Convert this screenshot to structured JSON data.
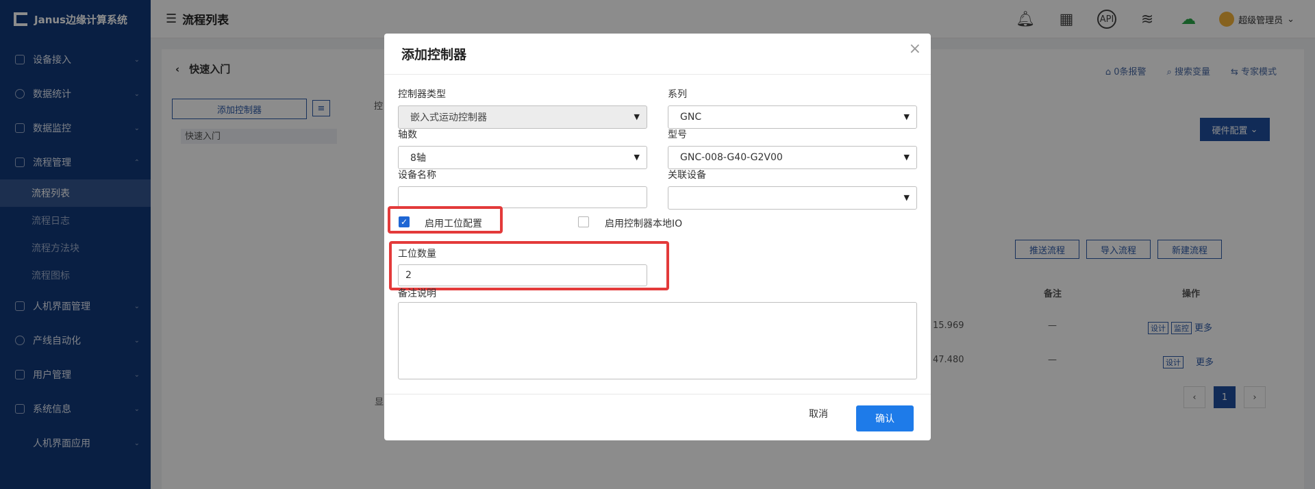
{
  "app": {
    "brand": "Janus边缘计算系统"
  },
  "sidebar": {
    "items": [
      {
        "label": "设备接入"
      },
      {
        "label": "数据统计"
      },
      {
        "label": "数据监控"
      },
      {
        "label": "流程管理"
      }
    ],
    "sub_items": [
      {
        "label": "流程列表"
      },
      {
        "label": "流程日志"
      },
      {
        "label": "流程方法块"
      },
      {
        "label": "流程图标"
      }
    ],
    "items2": [
      {
        "label": "人机界面管理"
      },
      {
        "label": "产线自动化"
      },
      {
        "label": "用户管理"
      },
      {
        "label": "系统信息"
      },
      {
        "label": "人机界面应用"
      }
    ]
  },
  "header": {
    "title": "流程列表",
    "user": "超级管理员"
  },
  "main": {
    "breadcrumb": "快速入门",
    "alerts": "0条报警",
    "search_var": "搜索变量",
    "expert_mode": "专家模式",
    "add_controller": "添加控制器",
    "tree_node": "快速入门",
    "hw_config": "硬件配置",
    "push_flow": "推送流程",
    "import_flow": "导入流程",
    "new_flow": "新建流程",
    "col_remark": "备注",
    "col_action": "操作",
    "row1_val": "15.969",
    "row2_val": "47.480",
    "dash": "—",
    "design": "设计",
    "monitor": "监控",
    "more": "更多",
    "page": "1",
    "partial_label": "控",
    "partial_show": "显"
  },
  "modal": {
    "title": "添加控制器",
    "controller_type_label": "控制器类型",
    "controller_type_value": "嵌入式运动控制器",
    "series_label": "系列",
    "series_value": "GNC",
    "axis_label": "轴数",
    "axis_value": "8轴",
    "model_label": "型号",
    "model_value": "GNC-008-G40-G2V00",
    "device_name_label": "设备名称",
    "device_name_value": "",
    "linked_device_label": "关联设备",
    "linked_device_value": "",
    "enable_station_label": "启用工位配置",
    "enable_local_io_label": "启用控制器本地IO",
    "station_count_label": "工位数量",
    "station_count_value": "2",
    "remark_label": "备注说明",
    "cancel": "取消",
    "confirm": "确认"
  }
}
